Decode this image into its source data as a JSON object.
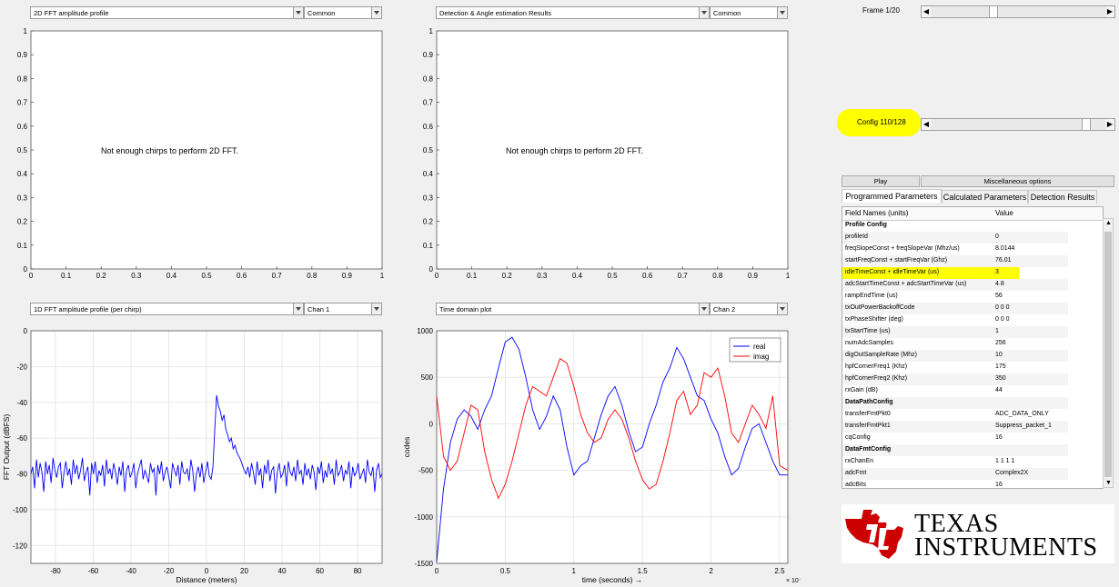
{
  "panels": {
    "p1": {
      "dropdown": "2D FFT amplitude profile",
      "mode": "Common",
      "message": "Not enough chirps to perform 2D FFT."
    },
    "p2": {
      "dropdown": "Detection & Angle estimation Results",
      "mode": "Common",
      "message": "Not enough chirps to perform 2D FFT."
    },
    "p3": {
      "dropdown": "1D FFT amplitude profile (per chirp)",
      "mode": "Chan 1",
      "xlabel": "Distance (meters)",
      "ylabel": "FFT Output (dBFS)"
    },
    "p4": {
      "dropdown": "Time domain plot",
      "mode": "Chan 2",
      "xlabel": "time  (seconds) →",
      "ylabel": "codes",
      "exponent": "× 10⁻⁵"
    }
  },
  "empty_ticks": {
    "x": [
      "0",
      "0.1",
      "0.2",
      "0.3",
      "0.4",
      "0.5",
      "0.6",
      "0.7",
      "0.8",
      "0.9",
      "1"
    ],
    "y": [
      "0",
      "0.1",
      "0.2",
      "0.3",
      "0.4",
      "0.5",
      "0.6",
      "0.7",
      "0.8",
      "0.9",
      "1"
    ]
  },
  "frame_label": "Frame 1/20",
  "config_label": "Config 110/128",
  "play_label": "Play",
  "misc_label": "Miscellaneous options",
  "tabs": [
    "Programmed Parameters",
    "Calculated Parameters",
    "Detection Results"
  ],
  "table": {
    "col_field": "Field Names    (units)",
    "col_value": "Value",
    "rows": [
      {
        "f": "Profile Config",
        "v": "",
        "section": true
      },
      {
        "f": "profileId",
        "v": "0"
      },
      {
        "f": "freqSlopeConst + freqSlopeVar (Mhz/us)",
        "v": "8.0144"
      },
      {
        "f": "startFreqConst + startFreqVar (Ghz)",
        "v": "76.01"
      },
      {
        "f": "idleTimeConst + idleTimeVar (us)",
        "v": "3",
        "highlight": true
      },
      {
        "f": "adcStartTimeConst + adcStartTimeVar (us)",
        "v": "4.8"
      },
      {
        "f": "rampEndTime (us)",
        "v": "56"
      },
      {
        "f": "txOutPowerBackoffCode",
        "v": "0 0 0"
      },
      {
        "f": "txPhaseShifter (deg)",
        "v": "0 0 0"
      },
      {
        "f": "txStartTime (us)",
        "v": "1"
      },
      {
        "f": "numAdcSamples",
        "v": "256"
      },
      {
        "f": "digOutSampleRate (Mhz)",
        "v": "10"
      },
      {
        "f": "hpfCornerFreq1 (Khz)",
        "v": "175"
      },
      {
        "f": "hpfCornerFreq2 (Khz)",
        "v": "350"
      },
      {
        "f": "rxGain (dB)",
        "v": "44"
      },
      {
        "f": "DataPathConfig",
        "v": "",
        "section": true
      },
      {
        "f": "transferFmtPkt0",
        "v": "ADC_DATA_ONLY"
      },
      {
        "f": "transferFmtPkt1",
        "v": "Suppress_packet_1"
      },
      {
        "f": "cqConfig",
        "v": "16"
      },
      {
        "f": "DataFmtConfig",
        "v": "",
        "section": true
      },
      {
        "f": "rxChanEn",
        "v": "1 1 1 1"
      },
      {
        "f": "adcFmt",
        "v": "Complex2X"
      },
      {
        "f": "adcBits",
        "v": "16"
      }
    ]
  },
  "logo": {
    "line1": "Texas",
    "line2": "Instruments",
    "color": "#cc0000"
  },
  "colors": {
    "highlight": "#ffff00",
    "blue_series": "#0000ff",
    "red_series": "#ff0000"
  },
  "chart_data": [
    {
      "type": "line",
      "xlabel": "Distance (meters)",
      "ylabel": "FFT Output (dBFS)",
      "xlim": [
        -93,
        93
      ],
      "ylim": [
        -130,
        0
      ],
      "xticks": [
        -80,
        -60,
        -40,
        -20,
        0,
        20,
        40,
        60,
        80
      ],
      "yticks": [
        0,
        -20,
        -40,
        -60,
        -80,
        -100,
        -120
      ],
      "series": [
        {
          "values": [
            -80,
            -76,
            -88,
            -72,
            -82,
            -74,
            -79,
            -90,
            -73,
            -80,
            -75,
            -85,
            -71,
            -78,
            -82,
            -76,
            -74,
            -88,
            -79,
            -73,
            -81,
            -77,
            -86,
            -72,
            -80,
            -75,
            -83,
            -78,
            -71,
            -84,
            -79,
            -76,
            -92,
            -74,
            -80,
            -73,
            -85,
            -78,
            -81,
            -75,
            -87,
            -72,
            -80,
            -77,
            -83,
            -74,
            -79,
            -86,
            -76,
            -81,
            -73,
            -90,
            -78,
            -75,
            -82,
            -79,
            -74,
            -88,
            -80,
            -76,
            -72,
            -83,
            -78,
            -81,
            -85,
            -74,
            -79,
            -77,
            -92,
            -75,
            -80,
            -73,
            -84,
            -79,
            -76,
            -82,
            -88,
            -74,
            -78,
            -81,
            -75,
            -86,
            -73,
            -79,
            -80,
            -77,
            -84,
            -72,
            -78,
            -90,
            -80,
            -76,
            -82,
            -74,
            -85,
            -79,
            -73,
            -81,
            -83,
            -76,
            -55,
            -36,
            -42,
            -45,
            -50,
            -47,
            -55,
            -58,
            -62,
            -60,
            -66,
            -64,
            -68,
            -70,
            -72,
            -75,
            -78,
            -80,
            -76,
            -82,
            -74,
            -79,
            -86,
            -73,
            -81,
            -77,
            -88,
            -75,
            -80,
            -72,
            -84,
            -78,
            -76,
            -91,
            -79,
            -74,
            -82,
            -80,
            -75,
            -87,
            -73,
            -79,
            -81,
            -76,
            -84,
            -72,
            -80,
            -78,
            -86,
            -74,
            -81,
            -77,
            -83,
            -75,
            -79,
            -89,
            -76,
            -80,
            -73,
            -85,
            -78,
            -82,
            -74,
            -80,
            -77,
            -86,
            -72,
            -81,
            -79,
            -75,
            -84,
            -78,
            -80,
            -73,
            -88,
            -76,
            -81,
            -79,
            -74,
            -83,
            -80,
            -77,
            -85,
            -72,
            -79,
            -81,
            -76,
            -90,
            -78,
            -74,
            -82,
            -80
          ]
        }
      ]
    },
    {
      "type": "line",
      "xlabel": "time  (seconds) →",
      "ylabel": "codes",
      "xlim": [
        0,
        2.56
      ],
      "ylim": [
        -1500,
        1000
      ],
      "xticks": [
        0,
        0.5,
        1,
        1.5,
        2,
        2.5
      ],
      "yticks": [
        1000,
        500,
        0,
        -500,
        -1000,
        -1500
      ],
      "legend": "top-right",
      "series": [
        {
          "name": "real",
          "color": "#0000ff",
          "x": [
            0,
            0.05,
            0.1,
            0.15,
            0.2,
            0.25,
            0.3,
            0.35,
            0.4,
            0.45,
            0.5,
            0.55,
            0.6,
            0.65,
            0.7,
            0.75,
            0.8,
            0.85,
            0.9,
            0.95,
            1.0,
            1.05,
            1.1,
            1.15,
            1.2,
            1.25,
            1.3,
            1.35,
            1.4,
            1.45,
            1.5,
            1.55,
            1.6,
            1.65,
            1.7,
            1.75,
            1.8,
            1.85,
            1.9,
            1.95,
            2.0,
            2.05,
            2.1,
            2.15,
            2.2,
            2.25,
            2.3,
            2.35,
            2.4,
            2.45,
            2.5,
            2.56
          ],
          "values": [
            -1480,
            -700,
            -200,
            50,
            150,
            80,
            -60,
            150,
            300,
            600,
            880,
            930,
            800,
            500,
            150,
            -60,
            80,
            300,
            150,
            -250,
            -550,
            -450,
            -400,
            -150,
            100,
            300,
            400,
            200,
            -80,
            -300,
            -250,
            0,
            200,
            450,
            600,
            820,
            700,
            500,
            300,
            250,
            50,
            -100,
            -350,
            -550,
            -480,
            -250,
            -50,
            0,
            -200,
            -400,
            -550,
            -550
          ]
        },
        {
          "name": "imag",
          "color": "#ff0000",
          "x": [
            0,
            0.05,
            0.1,
            0.15,
            0.2,
            0.25,
            0.3,
            0.35,
            0.4,
            0.45,
            0.5,
            0.55,
            0.6,
            0.65,
            0.7,
            0.75,
            0.8,
            0.85,
            0.9,
            0.95,
            1.0,
            1.05,
            1.1,
            1.15,
            1.2,
            1.25,
            1.3,
            1.35,
            1.4,
            1.45,
            1.5,
            1.55,
            1.6,
            1.65,
            1.7,
            1.75,
            1.8,
            1.85,
            1.9,
            1.95,
            2.0,
            2.05,
            2.1,
            2.15,
            2.2,
            2.25,
            2.3,
            2.35,
            2.4,
            2.45,
            2.5,
            2.56
          ],
          "values": [
            300,
            -350,
            -500,
            -400,
            -100,
            200,
            150,
            -300,
            -600,
            -800,
            -650,
            -400,
            -100,
            200,
            400,
            350,
            300,
            500,
            700,
            650,
            400,
            100,
            -100,
            -200,
            -150,
            50,
            150,
            50,
            -150,
            -400,
            -600,
            -700,
            -650,
            -400,
            -100,
            250,
            350,
            100,
            200,
            550,
            500,
            600,
            300,
            -100,
            -200,
            0,
            200,
            100,
            -50,
            300,
            -450,
            -500
          ]
        }
      ]
    }
  ]
}
